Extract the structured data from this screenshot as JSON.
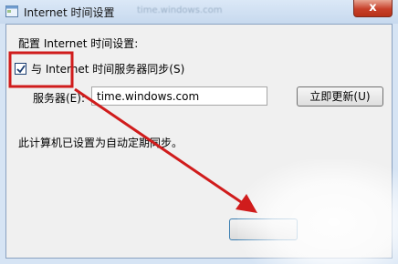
{
  "window": {
    "title": "Internet 时间设置",
    "background_title_text": "time.windows.com",
    "close_label": "x",
    "app_icon": "window-icon"
  },
  "dialog": {
    "heading": "配置 Internet 时间设置:",
    "sync_checkbox": {
      "label": "与 Internet 时间服务器同步(S)",
      "checked": true
    },
    "server_label": "服务器(E):",
    "server_value": "time.windows.com",
    "update_button": "立即更新(U)",
    "status_text": "此计算机已设置为自动定期同步。",
    "ok_button": ""
  },
  "annotation": {
    "color": "#d01c1c",
    "shapes": [
      "highlight-box",
      "arrow"
    ]
  }
}
